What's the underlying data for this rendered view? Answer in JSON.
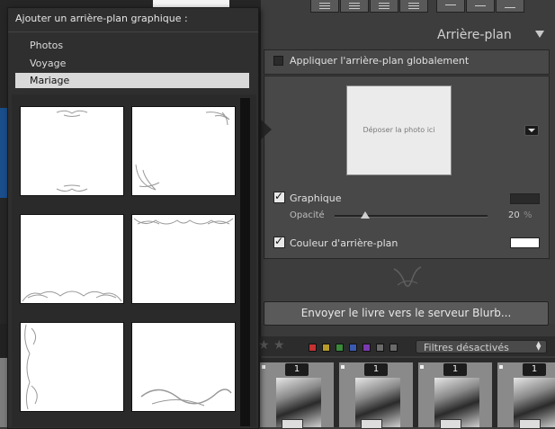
{
  "popup": {
    "title": "Ajouter un arrière-plan graphique :",
    "items": [
      {
        "label": "Photos",
        "selected": false
      },
      {
        "label": "Voyage",
        "selected": false
      },
      {
        "label": "Mariage",
        "selected": true
      }
    ],
    "thumbnails": [
      "mariage-1",
      "mariage-2",
      "mariage-3",
      "mariage-4",
      "mariage-5",
      "mariage-6"
    ]
  },
  "panel": {
    "section_title": "Arrière-plan",
    "apply_global_label": "Appliquer l'arrière-plan globalement",
    "apply_global_checked": false,
    "drop_zone_text": "Déposer la photo ici",
    "graphique_label": "Graphique",
    "graphique_checked": true,
    "opacity_label": "Opacité",
    "opacity_value": "20",
    "opacity_unit": "%",
    "opacity_fraction": 0.2,
    "bgcolor_label": "Couleur d'arrière-plan",
    "bgcolor_checked": true,
    "bgcolor_value": "#ffffff",
    "send_button_label": "Envoyer le livre vers le serveur Blurb..."
  },
  "filter_bar": {
    "select_value": "Filtres désactivés",
    "color_labels": [
      "#c43232",
      "#b79a2a",
      "#3a8a3a",
      "#3a5ab0",
      "#7a3ab0",
      "#6a6a6a",
      "#6a6a6a"
    ]
  },
  "filmstrip": {
    "cells": [
      {
        "badge": "1"
      },
      {
        "badge": "1"
      },
      {
        "badge": "1"
      },
      {
        "badge": "1"
      }
    ]
  }
}
